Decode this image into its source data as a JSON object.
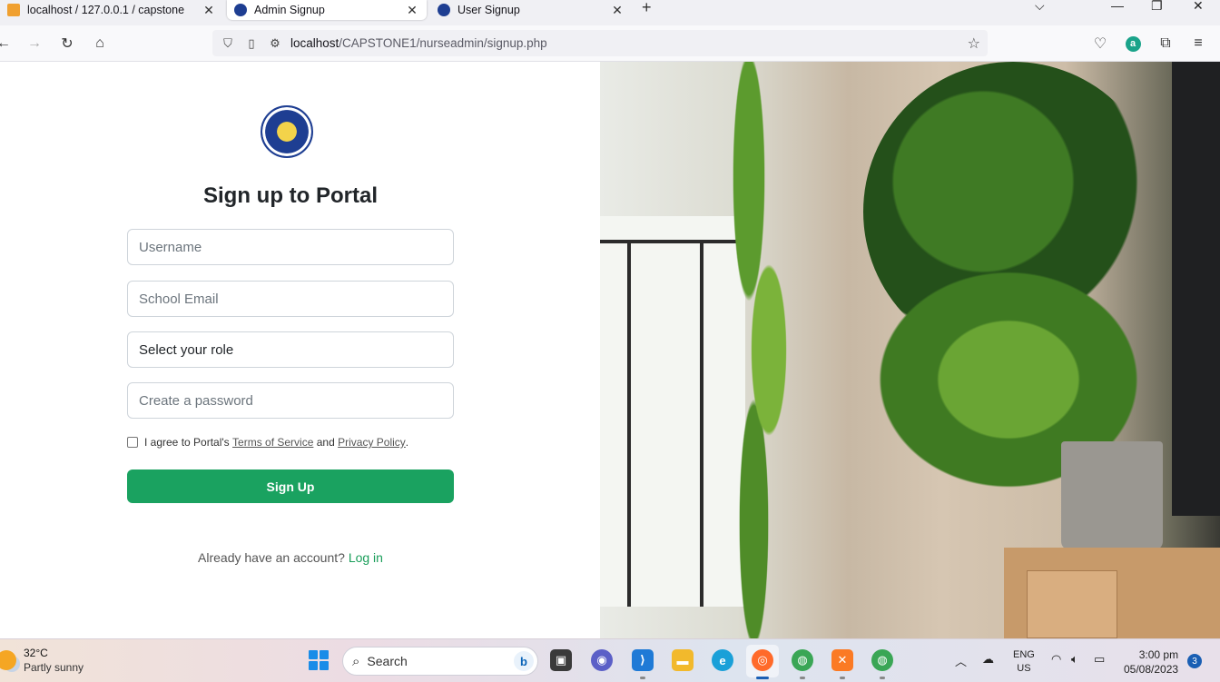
{
  "browser": {
    "tabs": [
      {
        "label": "localhost / 127.0.0.1 / capstone",
        "active": false
      },
      {
        "label": "Admin Signup",
        "active": true
      },
      {
        "label": "User Signup",
        "active": false
      }
    ],
    "url": {
      "host": "localhost",
      "path": "/CAPSTONE1/nurseadmin/signup.php"
    }
  },
  "form": {
    "title": "Sign up to Portal",
    "username_placeholder": "Username",
    "email_placeholder": "School Email",
    "role_selected": "Select your role",
    "password_placeholder": "Create a password",
    "agree_prefix": "I agree to Portal's",
    "terms_link": "Terms of Service",
    "and_text": "and",
    "privacy_link": "Privacy Policy",
    "period": ".",
    "submit_label": "Sign Up",
    "already_text": "Already have an account?",
    "login_link": "Log in"
  },
  "taskbar": {
    "temperature": "32°C",
    "weather": "Partly sunny",
    "search_label": "Search",
    "lang_line1": "ENG",
    "lang_line2": "US",
    "time": "3:00 pm",
    "date": "05/08/2023",
    "notifications": "3"
  },
  "colors": {
    "accent_green": "#1aa260",
    "login_green": "#1a9e5a"
  }
}
